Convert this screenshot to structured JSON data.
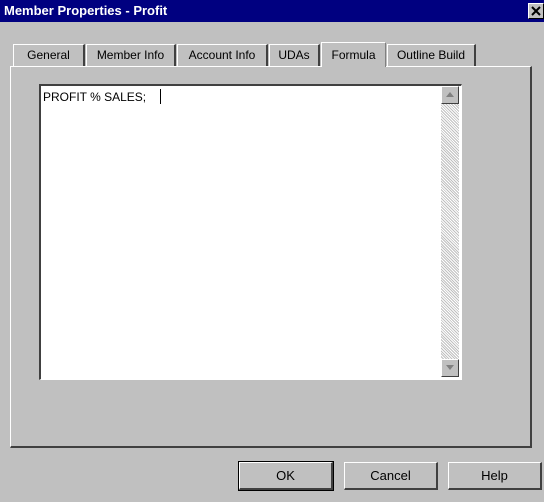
{
  "window": {
    "title": "Member Properties - Profit"
  },
  "tabs": [
    {
      "label": "General",
      "active": false
    },
    {
      "label": "Member Info",
      "active": false
    },
    {
      "label": "Account Info",
      "active": false
    },
    {
      "label": "UDAs",
      "active": false
    },
    {
      "label": "Formula",
      "active": true
    },
    {
      "label": "Outline Build",
      "active": false
    }
  ],
  "formula": {
    "text": "PROFIT % SALES;"
  },
  "buttons": {
    "ok": "OK",
    "cancel": "Cancel",
    "help": "Help"
  }
}
